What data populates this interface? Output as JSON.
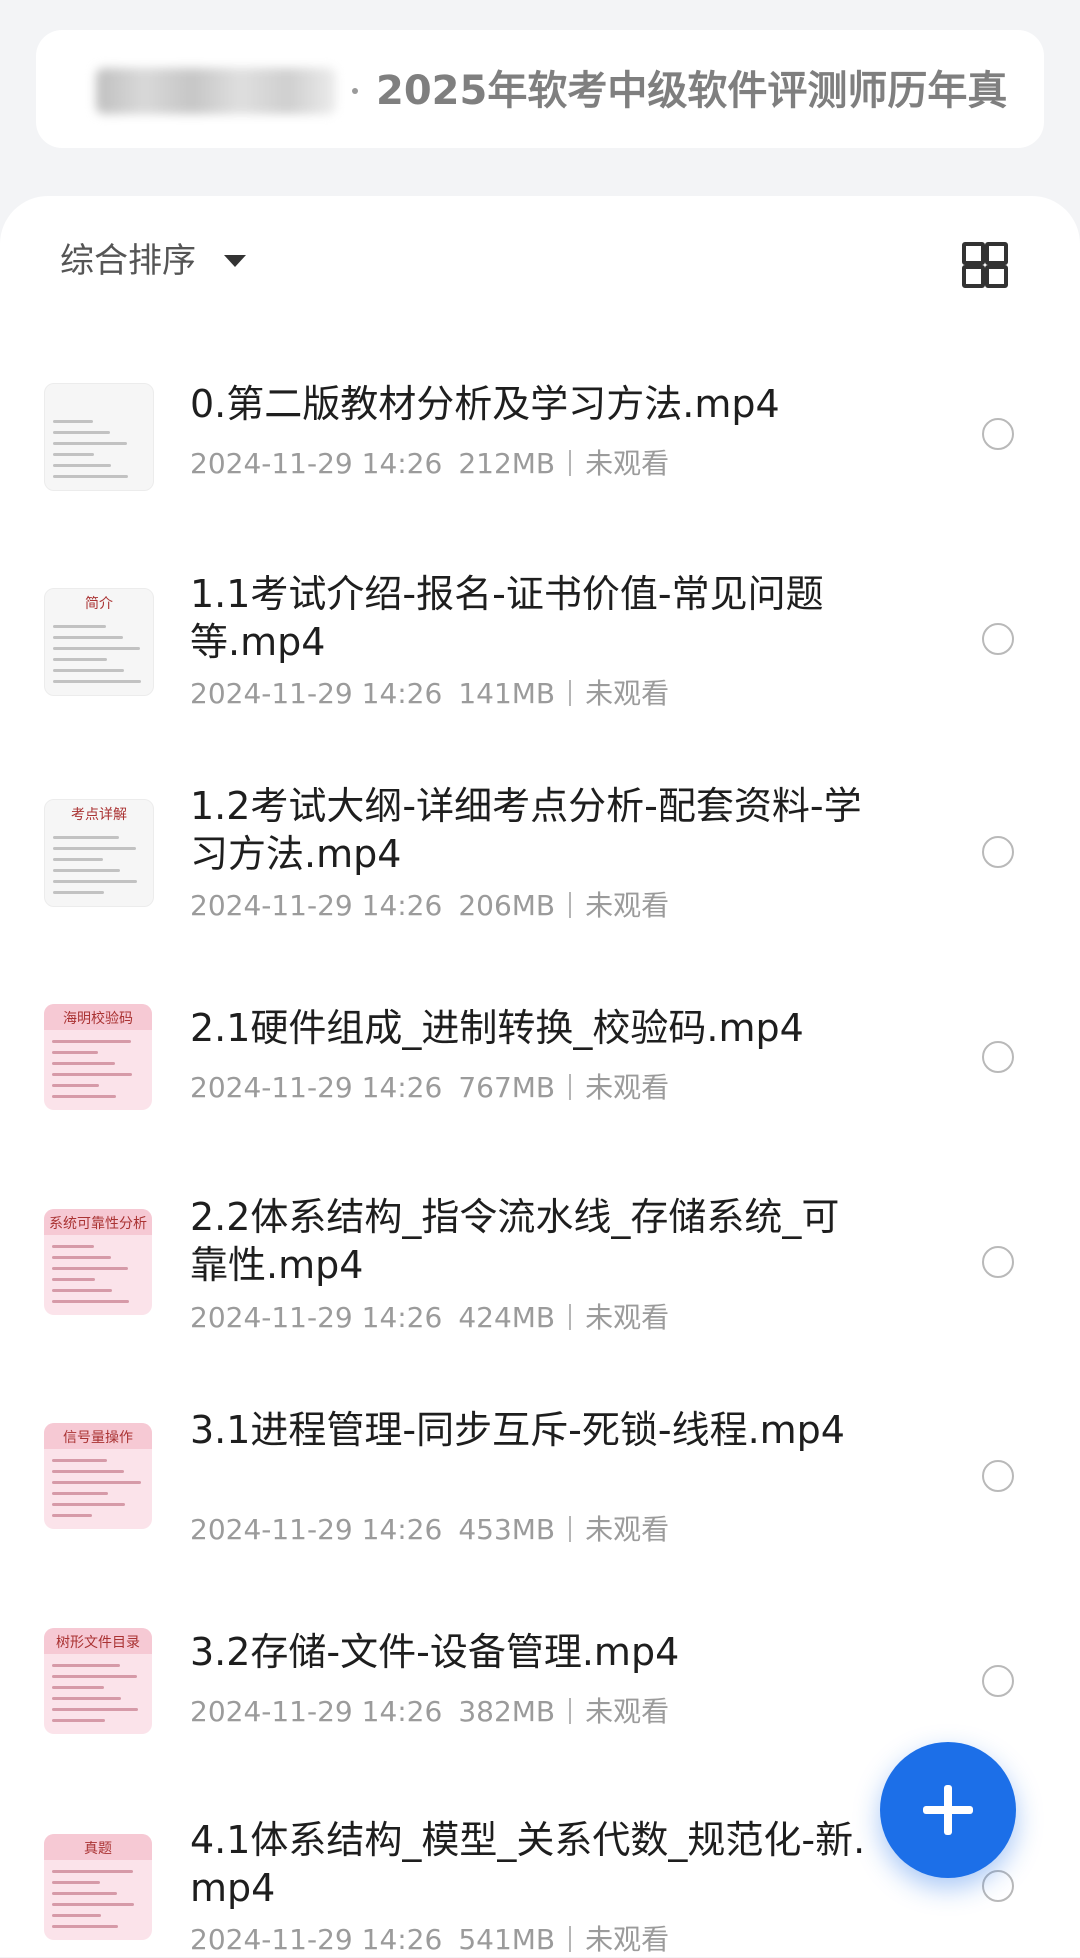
{
  "header": {
    "title": "2025年软考中级软件评测师历年真"
  },
  "toolbar": {
    "sort_label": "综合排序",
    "sort_icon": "caret-down-icon",
    "view_icon": "grid-view-icon"
  },
  "files": [
    {
      "name": "0.第二版教材分析及学习方法.mp4",
      "date": "2024-11-29 14:26",
      "size": "212MB",
      "status": "未观看"
    },
    {
      "name": "1.1考试介绍-报名-证书价值-常见问题等.mp4",
      "date": "2024-11-29 14:26",
      "size": "141MB",
      "status": "未观看"
    },
    {
      "name": "1.2考试大纲-详细考点分析-配套资料-学习方法.mp4",
      "date": "2024-11-29 14:26",
      "size": "206MB",
      "status": "未观看"
    },
    {
      "name": "2.1硬件组成_进制转换_校验码.mp4",
      "date": "2024-11-29 14:26",
      "size": "767MB",
      "status": "未观看"
    },
    {
      "name": "2.2体系结构_指令流水线_存储系统_可靠性.mp4",
      "date": "2024-11-29 14:26",
      "size": "424MB",
      "status": "未观看"
    },
    {
      "name": "3.1进程管理-同步互斥-死锁-线程.mp4",
      "date": "2024-11-29 14:26",
      "size": "453MB",
      "status": "未观看"
    },
    {
      "name": "3.2存储-文件-设备管理.mp4",
      "date": "2024-11-29 14:26",
      "size": "382MB",
      "status": "未观看"
    },
    {
      "name": "4.1体系结构_模型_关系代数_规范化-新.mp4",
      "date": "2024-11-29 14:26",
      "size": "541MB",
      "status": "未观看"
    }
  ],
  "thumbnails": [
    {
      "style": "white",
      "caption": ""
    },
    {
      "style": "white",
      "caption": "简介"
    },
    {
      "style": "white",
      "caption": "考点详解"
    },
    {
      "style": "pink",
      "caption": "海明校验码"
    },
    {
      "style": "pink",
      "caption": "系统可靠性分析"
    },
    {
      "style": "pink",
      "caption": "信号量操作"
    },
    {
      "style": "pink",
      "caption": "树形文件目录"
    },
    {
      "style": "pink",
      "caption": "真题"
    }
  ],
  "fab": {
    "icon": "plus-icon"
  },
  "colors": {
    "accent": "#1c6fe8",
    "background": "#f3f4f6"
  }
}
